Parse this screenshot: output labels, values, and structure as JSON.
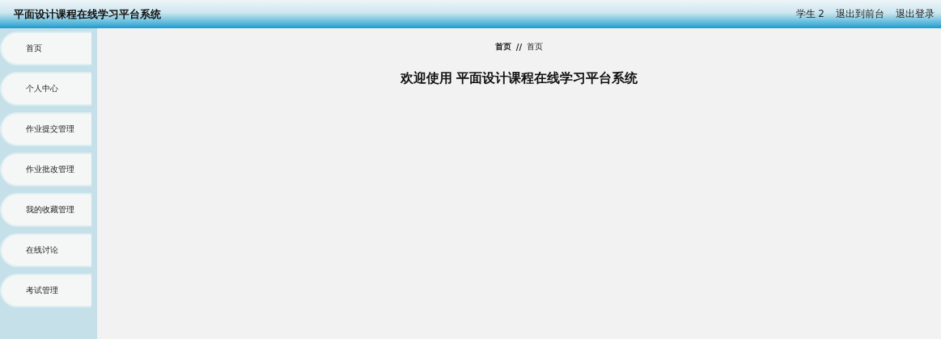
{
  "header": {
    "title": "平面设计课程在线学习平台系统",
    "user": "学生 2",
    "links": [
      "退出到前台",
      "退出登录"
    ]
  },
  "sidebar": {
    "items": [
      {
        "label": "首页"
      },
      {
        "label": "个人中心"
      },
      {
        "label": "作业提交管理"
      },
      {
        "label": "作业批改管理"
      },
      {
        "label": "我的收藏管理"
      },
      {
        "label": "在线讨论"
      },
      {
        "label": "考试管理"
      }
    ]
  },
  "breadcrumb": {
    "items": [
      "首页",
      "首页"
    ],
    "separator": "//"
  },
  "welcome": "欢迎使用 平面设计课程在线学习平台系统"
}
